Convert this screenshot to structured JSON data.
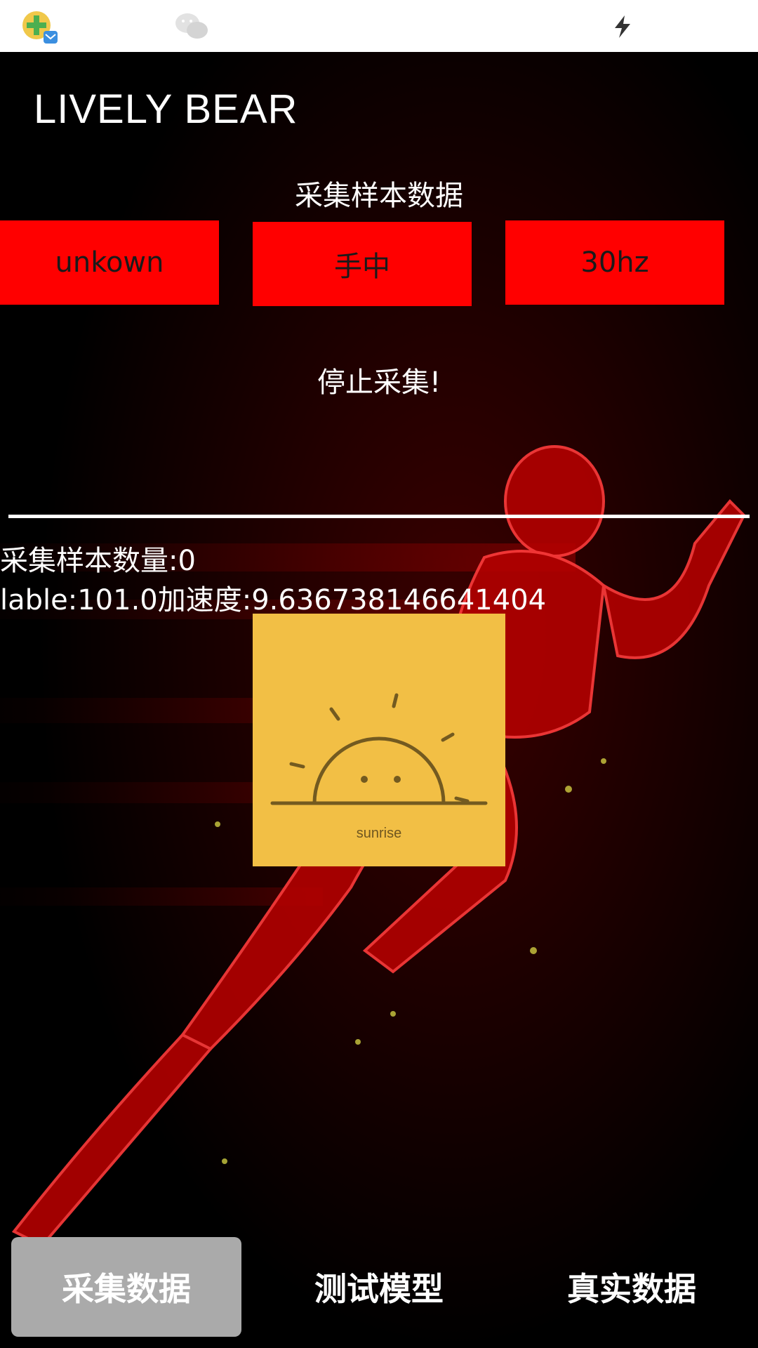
{
  "status_bar": {
    "icons": [
      "app-notification-icon",
      "wechat-icon",
      "flash-icon"
    ]
  },
  "app": {
    "title": "LIVELY BEAR"
  },
  "collect": {
    "section_title": "采集样本数据",
    "label_button": "unkown",
    "position_button": "手中",
    "frequency_button": "30hz",
    "stop_text": "停止采集!",
    "sample_count": "采集样本数量:0",
    "sensor_readout": "lable:101.0加速度:9.636738146641404"
  },
  "placeholder_card": {
    "icon": "sunrise-icon",
    "caption": "sunrise",
    "background": "#f2bf45"
  },
  "bottom_nav": {
    "items": [
      {
        "label": "采集数据",
        "active": true
      },
      {
        "label": "测试模型",
        "active": false
      },
      {
        "label": "真实数据",
        "active": false
      }
    ]
  },
  "colors": {
    "accent_red": "#ff0000",
    "active_tab": "#aaaaaa",
    "background": "#000000"
  }
}
